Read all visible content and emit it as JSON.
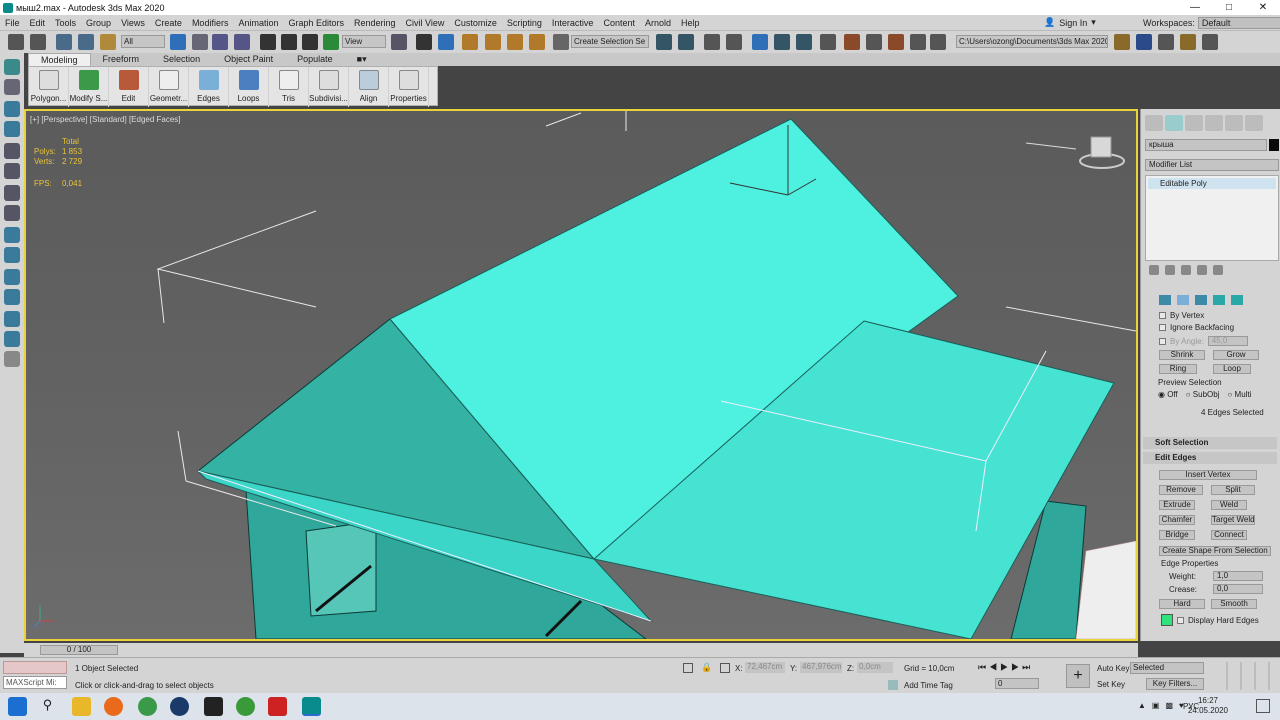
{
  "window": {
    "title": "мыш2.max - Autodesk 3ds Max 2020"
  },
  "menu": {
    "items": [
      "File",
      "Edit",
      "Tools",
      "Group",
      "Views",
      "Create",
      "Modifiers",
      "Animation",
      "Graph Editors",
      "Rendering",
      "Civil View",
      "Customize",
      "Scripting",
      "Interactive",
      "Content",
      "Arnold",
      "Help"
    ],
    "sign_in": "Sign In",
    "workspaces_label": "Workspaces:",
    "workspaces_value": "Default"
  },
  "toolbar": {
    "filter": "All",
    "refcoord": "View",
    "selection_set": "Create Selection Se",
    "path": "C:\\Users\\ozong\\Documents\\3ds Max 2020"
  },
  "ribbon": {
    "tabs": [
      "Modeling",
      "Freeform",
      "Selection",
      "Object Paint",
      "Populate"
    ],
    "buttons": [
      "Polygon...",
      "Modify S...",
      "Edit",
      "Geometr...",
      "Edges",
      "Loops",
      "Tris",
      "Subdivisi...",
      "Align",
      "Properties"
    ]
  },
  "viewport": {
    "label": "[+] [Perspective] [Standard] [Edged Faces]",
    "stats": {
      "total_label": "Total",
      "polys_label": "Polys:",
      "polys_value": "1 853",
      "verts_label": "Verts:",
      "verts_value": "2 729",
      "fps_label": "FPS:",
      "fps_value": "0,041"
    }
  },
  "command_panel": {
    "object_name": "крыша",
    "modifier_list": "Modifier List",
    "stack_item": "Editable Poly",
    "by_vertex": "By Vertex",
    "ignore_backfacing": "Ignore Backfacing",
    "by_angle_label": "By Angle:",
    "by_angle_value": "45,0",
    "shrink": "Shrink",
    "grow": "Grow",
    "ring": "Ring",
    "loop": "Loop",
    "preview_selection": "Preview Selection",
    "preview_off": "Off",
    "preview_subobj": "SubObj",
    "preview_multi": "Multi",
    "selection_info": "4 Edges Selected",
    "soft_selection": "Soft Selection",
    "edit_edges": "Edit Edges",
    "insert_vertex": "Insert Vertex",
    "remove": "Remove",
    "split": "Split",
    "extrude": "Extrude",
    "weld": "Weld",
    "chamfer": "Chamfer",
    "target_weld": "Target Weld",
    "bridge": "Bridge",
    "connect": "Connect",
    "create_shape": "Create Shape From Selection",
    "edge_properties": "Edge Properties",
    "weight_label": "Weight:",
    "weight_value": "1,0",
    "crease_label": "Crease:",
    "crease_value": "0,0",
    "hard": "Hard",
    "smooth": "Smooth",
    "display_hard_edges": "Display Hard Edges"
  },
  "timeline": {
    "frame": "0 / 100"
  },
  "status": {
    "selected": "1 Object Selected",
    "prompt": "Click or click-and-drag to select objects",
    "maxscript": "MAXScript Mi:",
    "x_label": "X:",
    "x_value": "72,467cm",
    "y_label": "Y:",
    "y_value": "467,976cm",
    "z_label": "Z:",
    "z_value": "0,0cm",
    "grid": "Grid = 10,0cm",
    "add_time_tag": "Add Time Tag",
    "auto_key": "Auto Key",
    "set_key": "Set Key",
    "key_mode": "Selected",
    "key_filters": "Key Filters...",
    "frame_field": "0"
  },
  "taskbar": {
    "lang": "РУС",
    "time": "16:27",
    "date": "24.05.2020"
  },
  "colors": {
    "roof": "#4ef0e0",
    "roof_shade": "#3cd6c8",
    "walls": "#2fa79a",
    "viewport_border": "#e8d43a",
    "stats": "#e8c43a"
  }
}
